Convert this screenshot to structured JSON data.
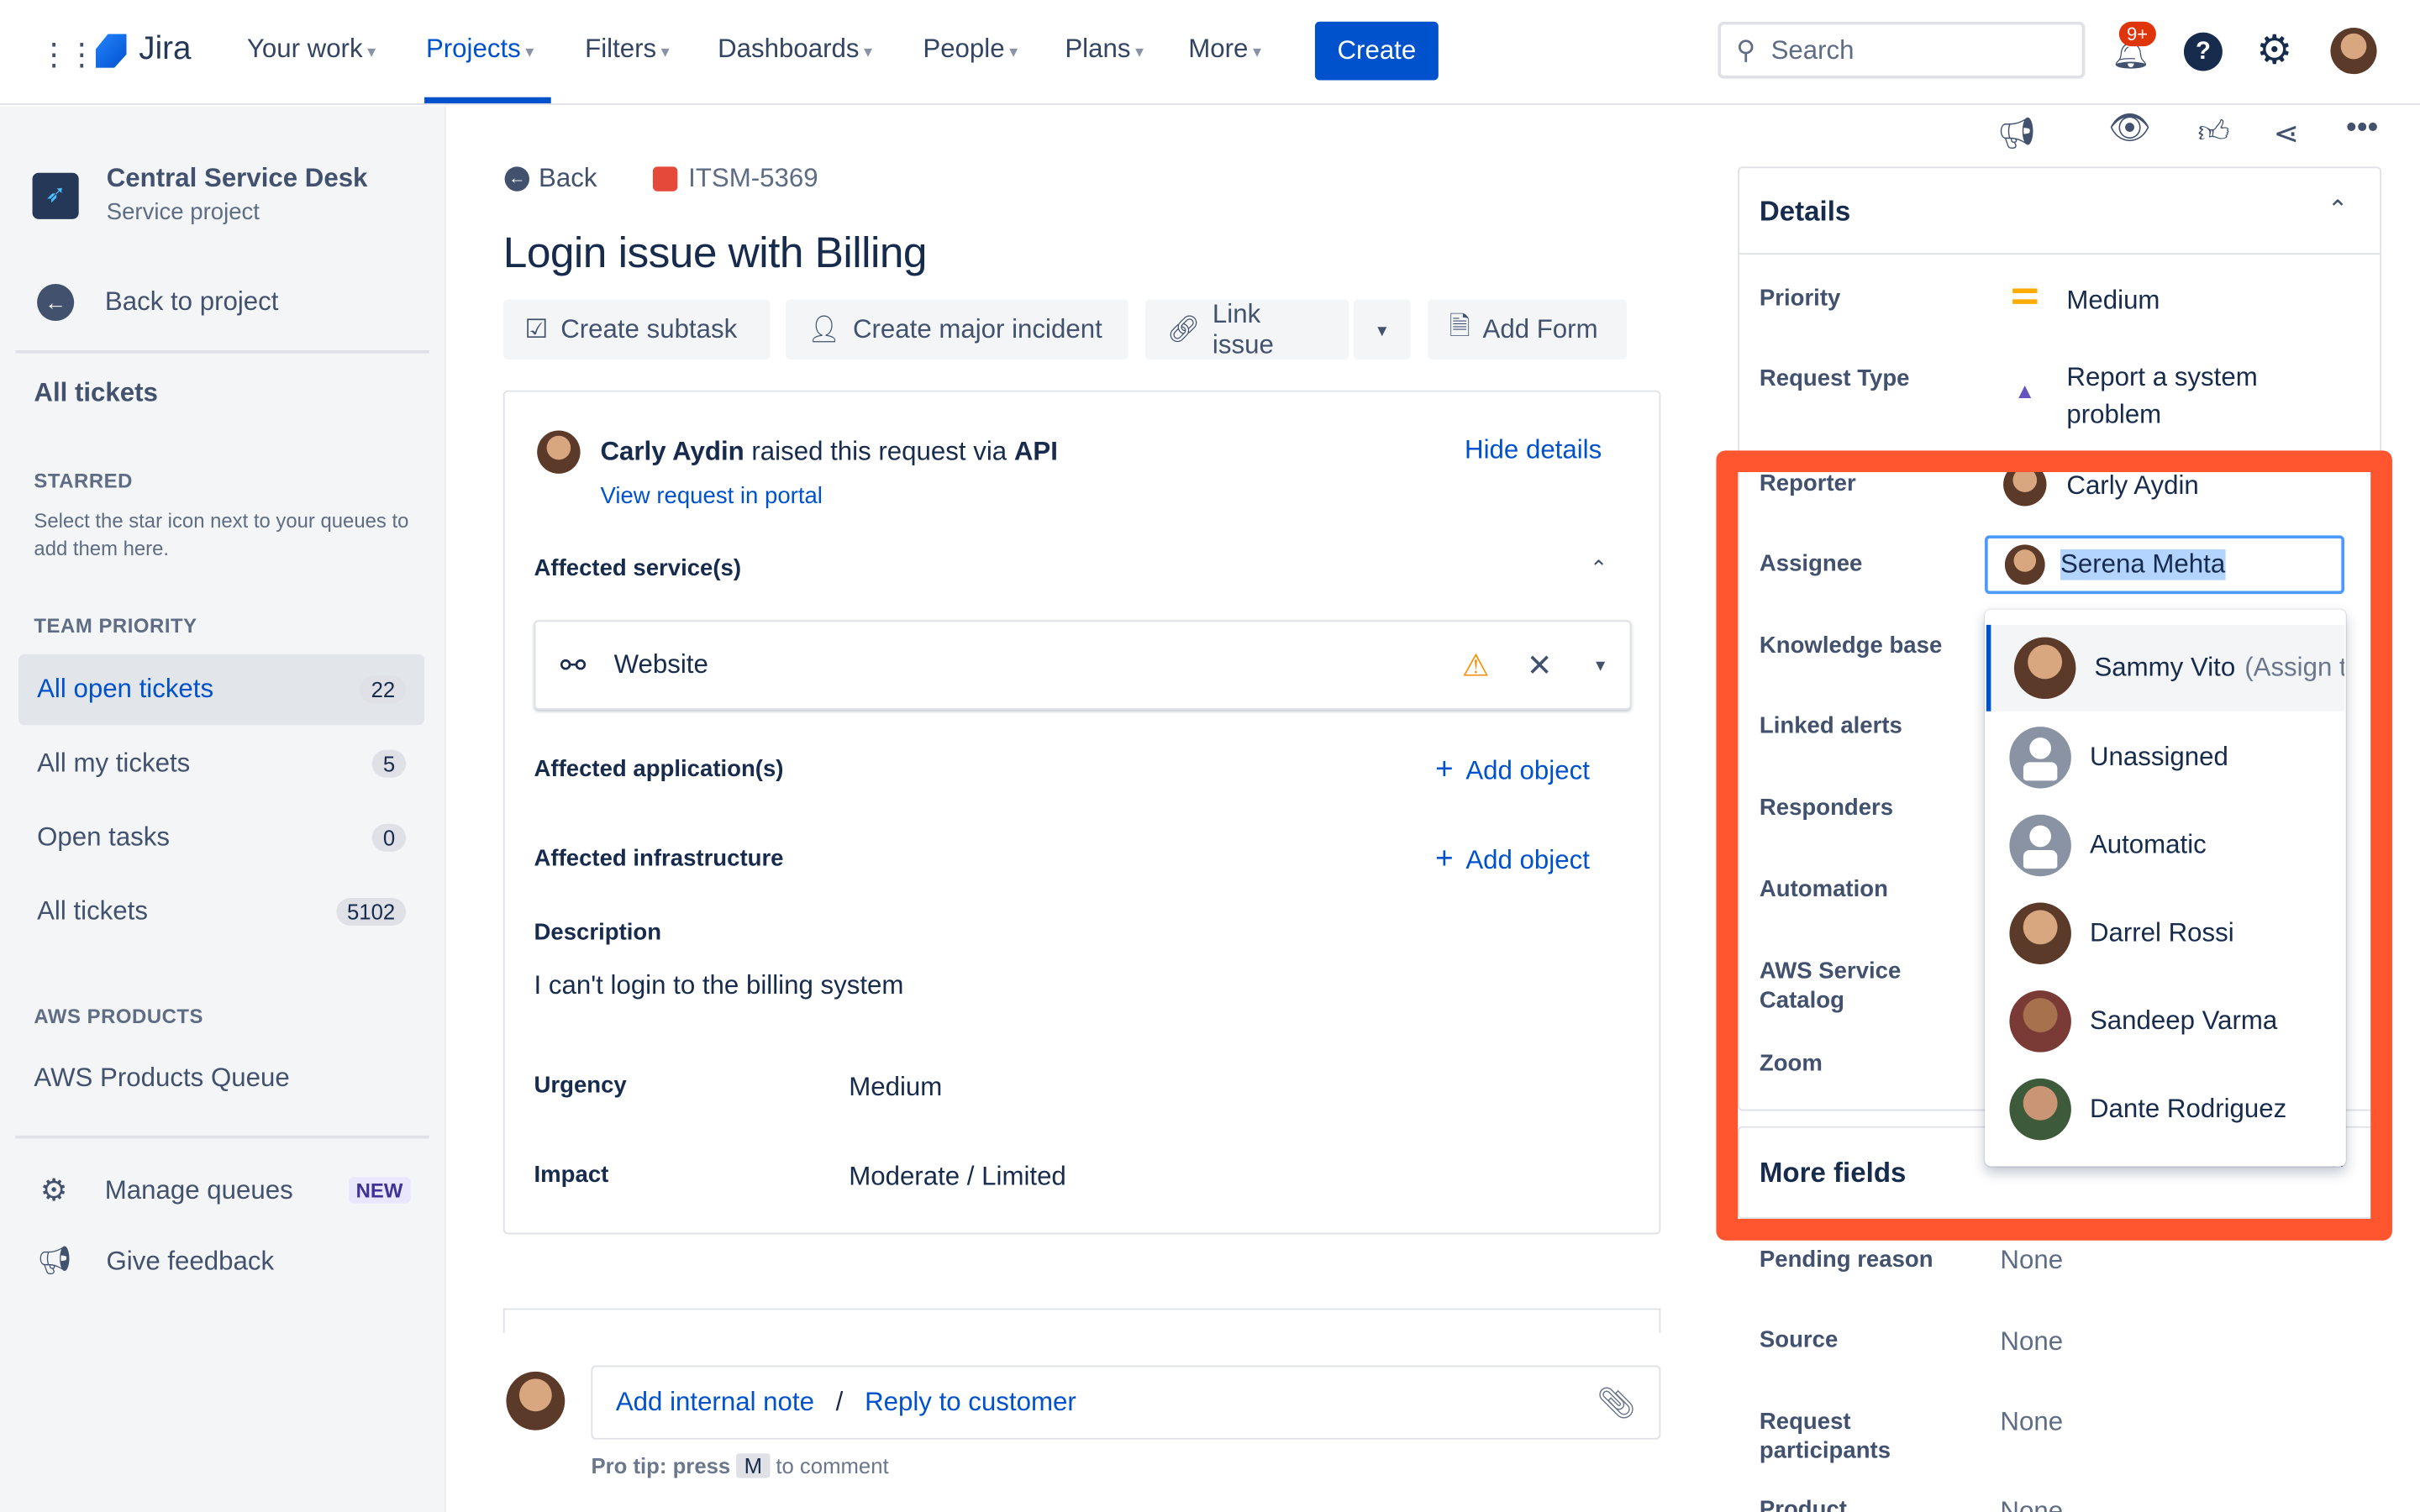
{
  "nav": {
    "product": "Jira",
    "items": [
      "Your work",
      "Projects",
      "Filters",
      "Dashboards",
      "People",
      "Plans",
      "More"
    ],
    "active": "Projects",
    "create": "Create",
    "search_placeholder": "Search",
    "notifications_badge": "9+"
  },
  "sidebar": {
    "project_name": "Central Service Desk",
    "project_type": "Service project",
    "back": "Back to project",
    "all_tickets_title": "All tickets",
    "starred_head": "STARRED",
    "starred_hint": "Select the star icon next to your queues to add them here.",
    "team_head": "TEAM PRIORITY",
    "queues": [
      {
        "label": "All open tickets",
        "count": "22"
      },
      {
        "label": "All my tickets",
        "count": "5"
      },
      {
        "label": "Open tasks",
        "count": "0"
      },
      {
        "label": "All tickets",
        "count": "5102"
      }
    ],
    "aws_head": "AWS PRODUCTS",
    "aws_queue": "AWS Products Queue",
    "manage": "Manage queues",
    "new_badge": "NEW",
    "feedback": "Give feedback"
  },
  "issue": {
    "back": "Back",
    "key": "ITSM-5369",
    "title": "Login issue with Billing",
    "actions": [
      "Create subtask",
      "Create major incident",
      "Link issue",
      "Add Form"
    ],
    "reporter": "Carly Aydin",
    "raised_text": "raised this request via",
    "channel": "API",
    "hide_details": "Hide details",
    "view_portal": "View request in portal",
    "affected_services_label": "Affected service(s)",
    "service": "Website",
    "affected_apps_label": "Affected application(s)",
    "affected_infra_label": "Affected infrastructure",
    "add_object": "Add object",
    "description_label": "Description",
    "description": "I can't login to the billing system",
    "urgency_label": "Urgency",
    "urgency": "Medium",
    "impact_label": "Impact",
    "impact": "Moderate / Limited",
    "add_note": "Add internal note",
    "sep": "/",
    "reply": "Reply to customer",
    "tip_prefix": "Pro tip: press",
    "tip_key": "M",
    "tip_suffix": "to comment"
  },
  "details": {
    "title": "Details",
    "fields": {
      "priority": "Priority",
      "priority_val": "Medium",
      "request_type": "Request Type",
      "request_type_val": "Report a system problem",
      "reporter": "Reporter",
      "reporter_val": "Carly Aydin",
      "assignee": "Assignee",
      "assignee_val": "Serena Mehta",
      "kb": "Knowledge base",
      "linked": "Linked alerts",
      "responders": "Responders",
      "automation": "Automation",
      "aws": "AWS Service Catalog",
      "zoom": "Zoom"
    },
    "more_fields": "More fields",
    "pending": "Pending reason",
    "pending_val": "None",
    "source": "Source",
    "source_val": "None",
    "participants": "Request participants",
    "participants_val": "None",
    "product": "Product",
    "product_val": "None"
  },
  "assignee_dropdown": [
    {
      "name": "Sammy Vito",
      "hint": "(Assign to me)"
    },
    {
      "name": "Unassigned"
    },
    {
      "name": "Automatic"
    },
    {
      "name": "Darrel Rossi"
    },
    {
      "name": "Sandeep Varma"
    },
    {
      "name": "Dante Rodriguez"
    }
  ],
  "colors": {
    "brand": "#0052cc",
    "highlight": "#ff5630",
    "priority_medium": "#ffab00",
    "warning": "#ff8b00"
  }
}
